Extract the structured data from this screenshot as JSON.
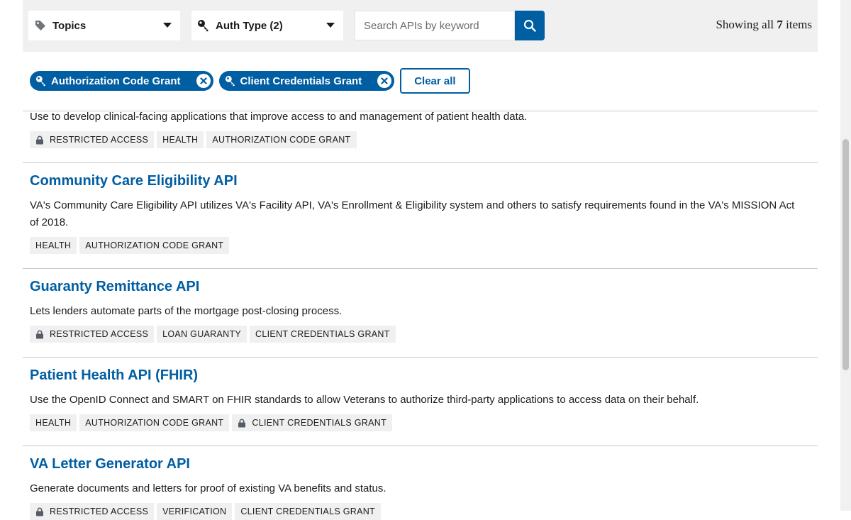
{
  "filters": {
    "topics_label": "Topics",
    "auth_type_label": "Auth Type (2)",
    "search_placeholder": "Search APIs by keyword",
    "showing_prefix": "Showing all",
    "showing_count": "7",
    "showing_suffix": "items"
  },
  "active_filters": {
    "chips": [
      "Authorization Code Grant",
      "Client Credentials Grant"
    ],
    "clear_all": "Clear all"
  },
  "apis": [
    {
      "title": "",
      "description": "Use to develop clinical-facing applications that improve access to and management of patient health data.",
      "tags": [
        {
          "label": "Restricted Access",
          "lock": true
        },
        {
          "label": "Health",
          "lock": false
        },
        {
          "label": "Authorization Code Grant",
          "lock": false
        }
      ]
    },
    {
      "title": "Community Care Eligibility API",
      "description": "VA's Community Care Eligibility API utilizes VA's Facility API, VA's Enrollment & Eligibility system and others to satisfy requirements found in the VA's MISSION Act of 2018.",
      "tags": [
        {
          "label": "Health",
          "lock": false
        },
        {
          "label": "Authorization Code Grant",
          "lock": false
        }
      ]
    },
    {
      "title": "Guaranty Remittance API",
      "description": "Lets lenders automate parts of the mortgage post-closing process.",
      "tags": [
        {
          "label": "Restricted Access",
          "lock": true
        },
        {
          "label": "Loan Guaranty",
          "lock": false
        },
        {
          "label": "Client Credentials Grant",
          "lock": false
        }
      ]
    },
    {
      "title": "Patient Health API (FHIR)",
      "description": "Use the OpenID Connect and SMART on FHIR standards to allow Veterans to authorize third-party applications to access data on their behalf.",
      "tags": [
        {
          "label": "Health",
          "lock": false
        },
        {
          "label": "Authorization Code Grant",
          "lock": false
        },
        {
          "label": "Client Credentials Grant",
          "lock": true
        }
      ]
    },
    {
      "title": "VA Letter Generator API",
      "description": "Generate documents and letters for proof of existing VA benefits and status.",
      "tags": [
        {
          "label": "Restricted Access",
          "lock": true
        },
        {
          "label": "Verification",
          "lock": false
        },
        {
          "label": "Client Credentials Grant",
          "lock": false
        }
      ]
    }
  ],
  "colors": {
    "primary": "#005ea2",
    "filter_bg": "#f0f0f0",
    "tag_bg": "#f0f0f0"
  },
  "icons": {
    "topics": "tag-icon",
    "auth_type": "key-icon",
    "search": "search-icon",
    "chip": "key-icon",
    "chip_remove": "close-icon",
    "restricted": "lock-icon"
  }
}
